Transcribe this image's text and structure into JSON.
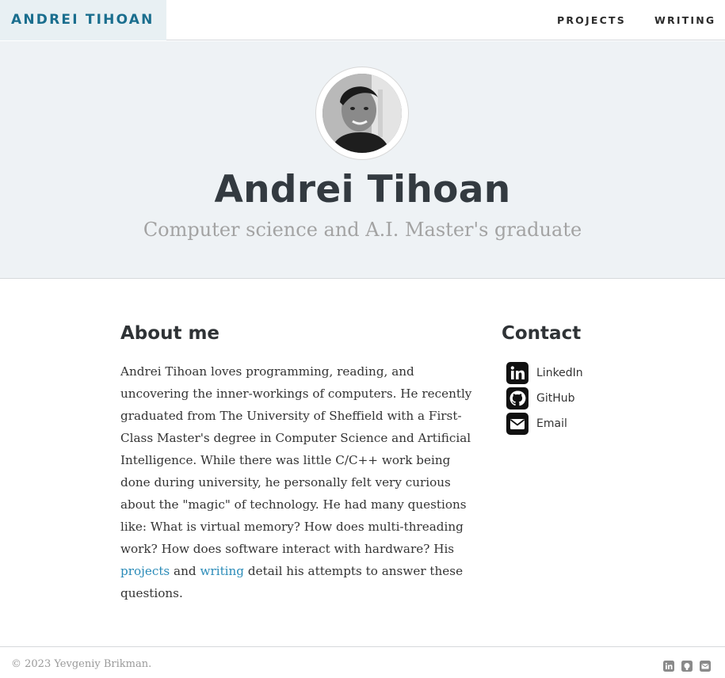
{
  "nav": {
    "brand": "ANDREI TIHOAN",
    "links": [
      "PROJECTS",
      "WRITING"
    ]
  },
  "hero": {
    "name": "Andrei Tihoan",
    "subtitle": "Computer science and A.I. Master's graduate"
  },
  "about": {
    "heading": "About me",
    "text_before": "Andrei Tihoan loves programming, reading, and uncovering the inner-workings of computers. He recently graduated from The University of Sheffield with a First-Class Master's degree in Computer Science and Artificial Intelligence. While there was little C/C++ work being done during university, he personally felt very curious about the \"magic\" of technology. He had many questions like: What is virtual memory? How does multi-threading work? How does software interact with hardware? His ",
    "link_projects": "projects",
    "text_and": " and ",
    "link_writing": "writing",
    "text_after": " detail his attempts to answer these questions."
  },
  "contact": {
    "heading": "Contact",
    "items": [
      {
        "label": "LinkedIn",
        "icon": "linkedin-icon"
      },
      {
        "label": "GitHub",
        "icon": "github-icon"
      },
      {
        "label": "Email",
        "icon": "email-icon"
      }
    ]
  },
  "footer": {
    "copyright": "© 2023 Yevgeniy Brikman.",
    "icons": [
      "linkedin-icon",
      "github-icon",
      "email-icon"
    ]
  },
  "colors": {
    "brand": "#1a6e8e",
    "brand_bg": "#e8f0f3",
    "hero_bg": "#eef2f5",
    "link": "#2a8bb8"
  }
}
